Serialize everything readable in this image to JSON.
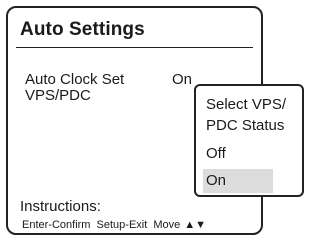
{
  "dialog": {
    "title": "Auto Settings"
  },
  "settings": [
    {
      "label": "Auto Clock Set",
      "value": "On"
    },
    {
      "label": "VPS/PDC",
      "value": ""
    }
  ],
  "popup": {
    "title": "Select VPS/\nPDC Status",
    "options": [
      "Off",
      "On"
    ],
    "selected": "On"
  },
  "instructions": {
    "label": "Instructions:",
    "enter": "Enter-Confirm",
    "setup": "Setup-Exit",
    "move": "Move",
    "arrows": "▲▼"
  },
  "colors": {
    "border": "#222222",
    "highlight": "#dcdcdc",
    "background": "#ffffff"
  }
}
